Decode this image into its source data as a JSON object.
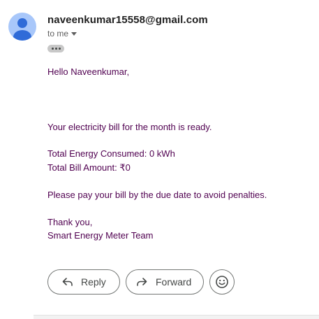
{
  "header": {
    "sender": "naveenkumar15558@gmail.com",
    "recipient_label": "to me",
    "avatar_icon": "person-icon",
    "avatar_color": "#a8c7fa"
  },
  "message": {
    "greeting": "Hello Naveenkumar,",
    "intro": "Your electricity bill for the month is ready.",
    "energy_line": "Total Energy Consumed: 0 kWh",
    "amount_line": "Total Bill Amount: ₹0",
    "reminder": "Please pay your bill by the due date to avoid penalties.",
    "signoff": "Thank you,",
    "signature": "Smart Energy Meter Team",
    "text_color": "#500050"
  },
  "actions": {
    "reply_label": "Reply",
    "forward_label": "Forward",
    "emoji_icon": "smiley-icon"
  }
}
